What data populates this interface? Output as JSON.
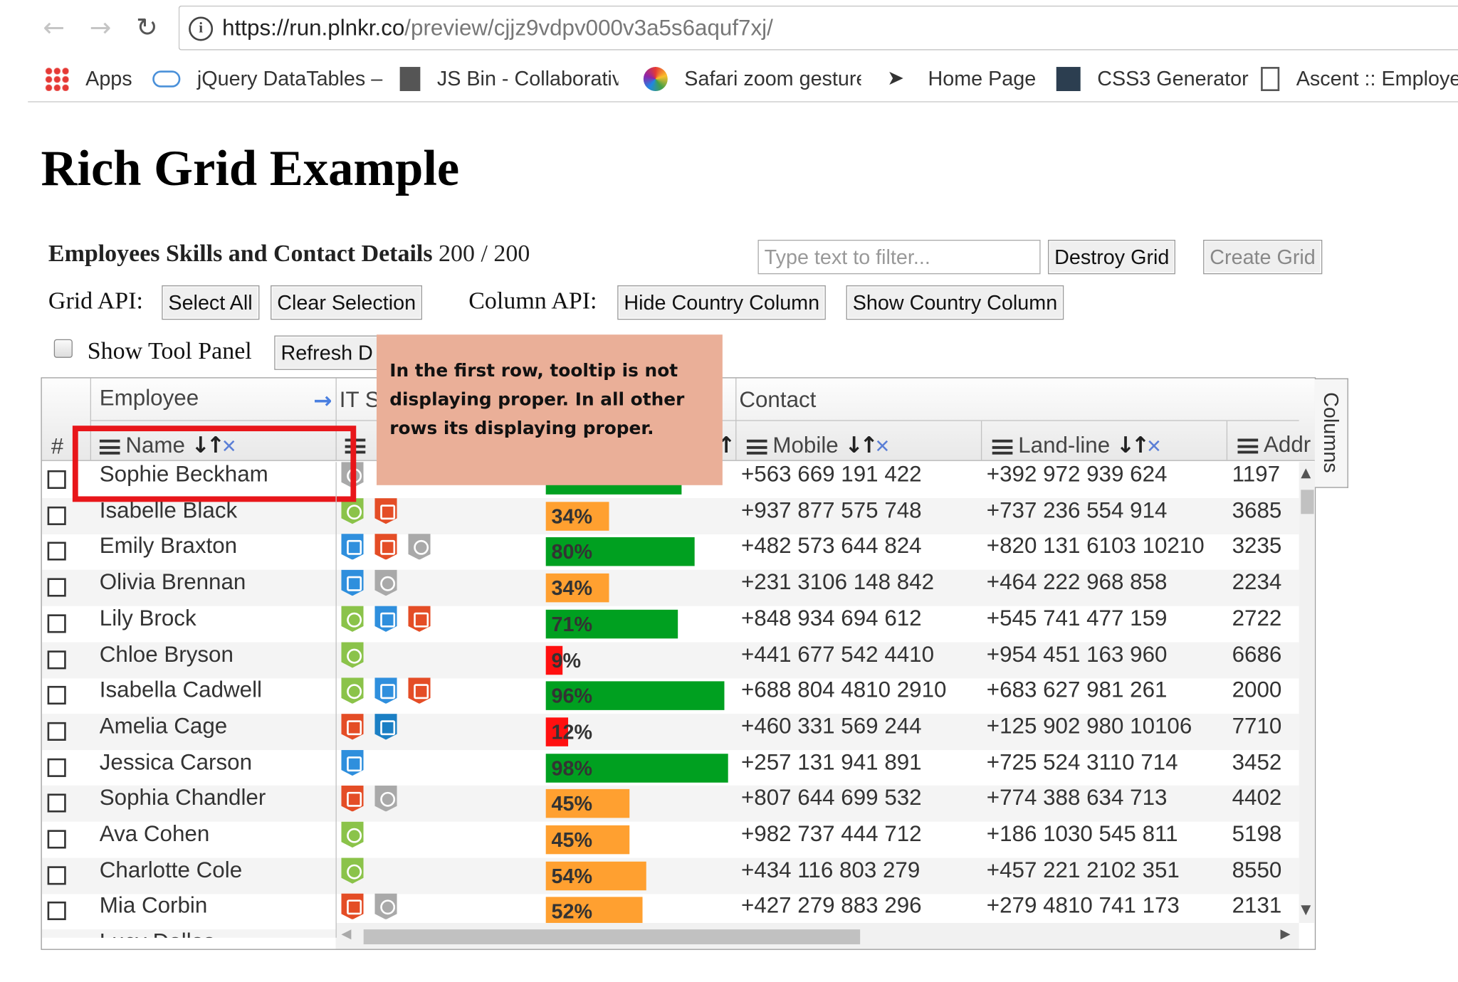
{
  "browser": {
    "url_host": "https://run.plnkr.co",
    "url_path": "/preview/cjjz9vdpv000v3a5s6aquf7xj/",
    "bookmarks": [
      "Apps",
      "jQuery DataTables –",
      "JS Bin - Collaborative",
      "Safari zoom gesture",
      "Home Page",
      "CSS3 Generator",
      "Ascent :: Employee"
    ]
  },
  "page": {
    "title": "Rich Grid Example",
    "heading_bold": "Employees Skills and Contact Details",
    "count": "200 / 200",
    "filter_placeholder": "Type text to filter...",
    "destroy_label": "Destroy Grid",
    "create_label": "Create Grid",
    "grid_api_label": "Grid API:",
    "select_all_label": "Select All",
    "clear_selection_label": "Clear Selection",
    "column_api_label": "Column API:",
    "hide_country_label": "Hide Country Column",
    "show_country_label": "Show Country Column",
    "show_tool_panel_label": "Show Tool Panel",
    "refresh_label": "Refresh D"
  },
  "grid": {
    "group_headers": {
      "employee": "Employee",
      "it": "IT S",
      "contact": "Contact"
    },
    "columns": {
      "hash": "#",
      "name": "Name",
      "mobile": "Mobile",
      "landline": "Land-line",
      "address": "Addr"
    },
    "tool_panel_label": "Columns",
    "rows": [
      {
        "name": "Sophie Beckham",
        "skills": [
          "mac"
        ],
        "proficiency": 73,
        "prof_text": "",
        "mobile": "+563 669 191 422",
        "landline": "+392 972 939 624",
        "address": "1197"
      },
      {
        "name": "Isabelle Black",
        "skills": [
          "android",
          "html5"
        ],
        "proficiency": 34,
        "prof_text": "34%",
        "mobile": "+937 877 575 748",
        "landline": "+737 236 554 914",
        "address": "3685"
      },
      {
        "name": "Emily Braxton",
        "skills": [
          "css3",
          "html5",
          "mac"
        ],
        "proficiency": 80,
        "prof_text": "80%",
        "mobile": "+482 573 644 824",
        "landline": "+820 131 6103 10210",
        "address": "3235"
      },
      {
        "name": "Olivia Brennan",
        "skills": [
          "css3",
          "mac"
        ],
        "proficiency": 34,
        "prof_text": "34%",
        "mobile": "+231 3106 148 842",
        "landline": "+464 222 968 858",
        "address": "2234"
      },
      {
        "name": "Lily Brock",
        "skills": [
          "android",
          "css3",
          "html5"
        ],
        "proficiency": 71,
        "prof_text": "71%",
        "mobile": "+848 934 694 612",
        "landline": "+545 741 477 159",
        "address": "2722"
      },
      {
        "name": "Chloe Bryson",
        "skills": [
          "android"
        ],
        "proficiency": 9,
        "prof_text": "9%",
        "mobile": "+441 677 542 4410",
        "landline": "+954 451 163 960",
        "address": "6686"
      },
      {
        "name": "Isabella Cadwell",
        "skills": [
          "android",
          "css3",
          "html5"
        ],
        "proficiency": 96,
        "prof_text": "96%",
        "mobile": "+688 804 4810 2910",
        "landline": "+683 627 981 261",
        "address": "2000"
      },
      {
        "name": "Amelia Cage",
        "skills": [
          "html5",
          "windows"
        ],
        "proficiency": 12,
        "prof_text": "12%",
        "mobile": "+460 331 569 244",
        "landline": "+125 902 980 10106",
        "address": "7710"
      },
      {
        "name": "Jessica Carson",
        "skills": [
          "css3"
        ],
        "proficiency": 98,
        "prof_text": "98%",
        "mobile": "+257 131 941 891",
        "landline": "+725 524 3110 714",
        "address": "3452"
      },
      {
        "name": "Sophia Chandler",
        "skills": [
          "html5",
          "mac"
        ],
        "proficiency": 45,
        "prof_text": "45%",
        "mobile": "+807 644 699 532",
        "landline": "+774 388 634 713",
        "address": "4402"
      },
      {
        "name": "Ava Cohen",
        "skills": [
          "android"
        ],
        "proficiency": 45,
        "prof_text": "45%",
        "mobile": "+982 737 444 712",
        "landline": "+186 1030 545 811",
        "address": "5198"
      },
      {
        "name": "Charlotte Cole",
        "skills": [
          "android"
        ],
        "proficiency": 54,
        "prof_text": "54%",
        "mobile": "+434 116 803 279",
        "landline": "+457 221 2102 351",
        "address": "8550"
      },
      {
        "name": "Mia Corbin",
        "skills": [
          "html5",
          "mac"
        ],
        "proficiency": 52,
        "prof_text": "52%",
        "mobile": "+427 279 883 296",
        "landline": "+279 4810 741 173",
        "address": "2131"
      },
      {
        "name": "Lucy Dallas",
        "skills": [],
        "proficiency": 0,
        "prof_text": "",
        "mobile": "",
        "landline": "",
        "address": ""
      }
    ]
  },
  "annotation": {
    "text": "In the first row, tooltip is not displaying proper. In all other rows its displaying proper."
  },
  "colors": {
    "bar_high": "#00a020",
    "bar_mid": "#ffa030",
    "bar_low": "#ff1010",
    "highlight_box": "#e8161a",
    "tooltip_bg": "#eaaf98"
  }
}
